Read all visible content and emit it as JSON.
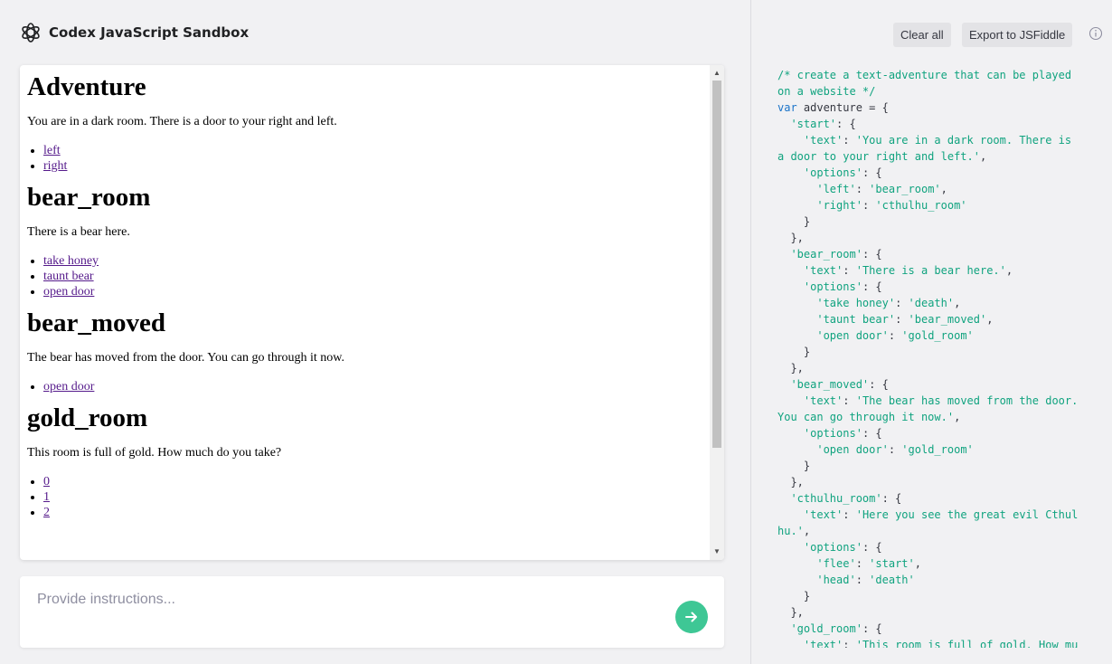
{
  "app": {
    "title": "Codex JavaScript Sandbox"
  },
  "preview": {
    "rooms": [
      {
        "name": "Adventure",
        "text": "You are in a dark room. There is a door to your right and left.",
        "options": [
          "left",
          "right"
        ]
      },
      {
        "name": "bear_room",
        "text": "There is a bear here.",
        "options": [
          "take honey",
          "taunt bear",
          "open door"
        ]
      },
      {
        "name": "bear_moved",
        "text": "The bear has moved from the door. You can go through it now.",
        "options": [
          "open door"
        ]
      },
      {
        "name": "gold_room",
        "text": "This room is full of gold. How much do you take?",
        "options": [
          "0",
          "1",
          "2"
        ]
      }
    ]
  },
  "input": {
    "placeholder": "Provide instructions..."
  },
  "toolbar": {
    "clear_label": "Clear all",
    "export_label": "Export to JSFiddle"
  },
  "icons": {
    "logo": "openai-logo-icon",
    "send": "arrow-right-icon",
    "info": "info-icon",
    "scroll_up": "scroll-up-arrow-icon",
    "scroll_down": "scroll-down-arrow-icon"
  },
  "colors": {
    "accent": "#3ec795",
    "link": "#551a8b",
    "code_comment": "#10a37f",
    "code_keyword": "#1a73c9"
  },
  "code": {
    "lines": [
      [
        [
          "c",
          "/* create a text-adventure that can be played"
        ]
      ],
      [
        [
          "c",
          "on a website */"
        ]
      ],
      [
        [
          "k",
          "var"
        ],
        [
          "p",
          " adventure = {"
        ]
      ],
      [
        [
          "p",
          "  "
        ],
        [
          "s",
          "'start'"
        ],
        [
          "p",
          ": {"
        ]
      ],
      [
        [
          "p",
          "    "
        ],
        [
          "s",
          "'text'"
        ],
        [
          "p",
          ": "
        ],
        [
          "s",
          "'You are in a dark room. There is"
        ]
      ],
      [
        [
          "s",
          "a door to your right and left.'"
        ],
        [
          "p",
          ","
        ]
      ],
      [
        [
          "p",
          "    "
        ],
        [
          "s",
          "'options'"
        ],
        [
          "p",
          ": {"
        ]
      ],
      [
        [
          "p",
          "      "
        ],
        [
          "s",
          "'left'"
        ],
        [
          "p",
          ": "
        ],
        [
          "s",
          "'bear_room'"
        ],
        [
          "p",
          ","
        ]
      ],
      [
        [
          "p",
          "      "
        ],
        [
          "s",
          "'right'"
        ],
        [
          "p",
          ": "
        ],
        [
          "s",
          "'cthulhu_room'"
        ]
      ],
      [
        [
          "p",
          "    }"
        ]
      ],
      [
        [
          "p",
          "  },"
        ]
      ],
      [
        [
          "p",
          "  "
        ],
        [
          "s",
          "'bear_room'"
        ],
        [
          "p",
          ": {"
        ]
      ],
      [
        [
          "p",
          "    "
        ],
        [
          "s",
          "'text'"
        ],
        [
          "p",
          ": "
        ],
        [
          "s",
          "'There is a bear here.'"
        ],
        [
          "p",
          ","
        ]
      ],
      [
        [
          "p",
          "    "
        ],
        [
          "s",
          "'options'"
        ],
        [
          "p",
          ": {"
        ]
      ],
      [
        [
          "p",
          "      "
        ],
        [
          "s",
          "'take honey'"
        ],
        [
          "p",
          ": "
        ],
        [
          "s",
          "'death'"
        ],
        [
          "p",
          ","
        ]
      ],
      [
        [
          "p",
          "      "
        ],
        [
          "s",
          "'taunt bear'"
        ],
        [
          "p",
          ": "
        ],
        [
          "s",
          "'bear_moved'"
        ],
        [
          "p",
          ","
        ]
      ],
      [
        [
          "p",
          "      "
        ],
        [
          "s",
          "'open door'"
        ],
        [
          "p",
          ": "
        ],
        [
          "s",
          "'gold_room'"
        ]
      ],
      [
        [
          "p",
          "    }"
        ]
      ],
      [
        [
          "p",
          "  },"
        ]
      ],
      [
        [
          "p",
          "  "
        ],
        [
          "s",
          "'bear_moved'"
        ],
        [
          "p",
          ": {"
        ]
      ],
      [
        [
          "p",
          "    "
        ],
        [
          "s",
          "'text'"
        ],
        [
          "p",
          ": "
        ],
        [
          "s",
          "'The bear has moved from the door."
        ]
      ],
      [
        [
          "s",
          "You can go through it now.'"
        ],
        [
          "p",
          ","
        ]
      ],
      [
        [
          "p",
          "    "
        ],
        [
          "s",
          "'options'"
        ],
        [
          "p",
          ": {"
        ]
      ],
      [
        [
          "p",
          "      "
        ],
        [
          "s",
          "'open door'"
        ],
        [
          "p",
          ": "
        ],
        [
          "s",
          "'gold_room'"
        ]
      ],
      [
        [
          "p",
          "    }"
        ]
      ],
      [
        [
          "p",
          "  },"
        ]
      ],
      [
        [
          "p",
          "  "
        ],
        [
          "s",
          "'cthulhu_room'"
        ],
        [
          "p",
          ": {"
        ]
      ],
      [
        [
          "p",
          "    "
        ],
        [
          "s",
          "'text'"
        ],
        [
          "p",
          ": "
        ],
        [
          "s",
          "'Here you see the great evil Cthul"
        ]
      ],
      [
        [
          "s",
          "hu.'"
        ],
        [
          "p",
          ","
        ]
      ],
      [
        [
          "p",
          "    "
        ],
        [
          "s",
          "'options'"
        ],
        [
          "p",
          ": {"
        ]
      ],
      [
        [
          "p",
          "      "
        ],
        [
          "s",
          "'flee'"
        ],
        [
          "p",
          ": "
        ],
        [
          "s",
          "'start'"
        ],
        [
          "p",
          ","
        ]
      ],
      [
        [
          "p",
          "      "
        ],
        [
          "s",
          "'head'"
        ],
        [
          "p",
          ": "
        ],
        [
          "s",
          "'death'"
        ]
      ],
      [
        [
          "p",
          "    }"
        ]
      ],
      [
        [
          "p",
          "  },"
        ]
      ],
      [
        [
          "p",
          "  "
        ],
        [
          "s",
          "'gold_room'"
        ],
        [
          "p",
          ": {"
        ]
      ],
      [
        [
          "p",
          "    "
        ],
        [
          "s",
          "'text'"
        ],
        [
          "p",
          ": "
        ],
        [
          "s",
          "'This room is full of gold. How mu"
        ]
      ]
    ]
  }
}
